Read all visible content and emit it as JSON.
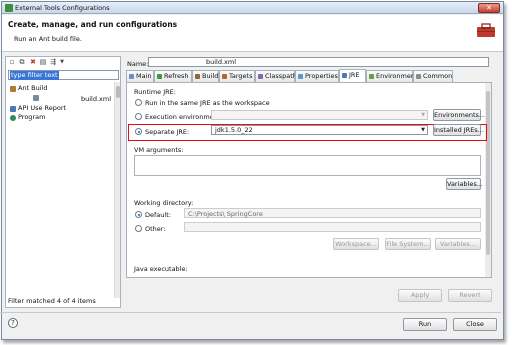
{
  "window": {
    "title": "External Tools Configurations",
    "close_glyph": "✕"
  },
  "header": {
    "title": "Create, manage, and run configurations",
    "subtitle": "Run an Ant build file."
  },
  "left": {
    "filter_placeholder": "type filter text",
    "tree": [
      {
        "label": "Ant Build",
        "icon": "ant-build-icon"
      },
      {
        "label": "build.xml",
        "icon": "ant-file-icon"
      },
      {
        "label": "API Use Report",
        "icon": "report-icon"
      },
      {
        "label": "Program",
        "icon": "program-icon"
      }
    ],
    "status": "Filter matched 4 of 4 items"
  },
  "config": {
    "name_label": "Name:",
    "name_value": "build.xml"
  },
  "tabs": [
    "Main",
    "Refresh",
    "Build",
    "Targets",
    "Classpath",
    "Properties",
    "JRE",
    "Environment",
    "Common"
  ],
  "jre": {
    "section_label": "Runtime JRE:",
    "opt_same": "Run in the same JRE as the workspace",
    "opt_exec_env": "Execution environment:",
    "btn_environments": "Environments...",
    "opt_separate": "Separate JRE:",
    "separate_value": "jdk1.5.0_22",
    "btn_installed": "Installed JREs...",
    "vm_label": "VM arguments:",
    "btn_variables": "Variables...",
    "workdir_label": "Working directory:",
    "opt_default": "Default:",
    "default_path": "C:\\Projects\\          SpringCore",
    "opt_other": "Other:",
    "btn_workspace": "Workspace...",
    "btn_filesystem": "File System...",
    "btn_variables2": "Variables...",
    "java_exec_label": "Java executable:"
  },
  "actions": {
    "apply": "Apply",
    "revert": "Revert",
    "run": "Run",
    "close": "Close",
    "help": "?"
  },
  "colors": {
    "highlight_box": "#e01010",
    "selection": "#3875d7"
  }
}
